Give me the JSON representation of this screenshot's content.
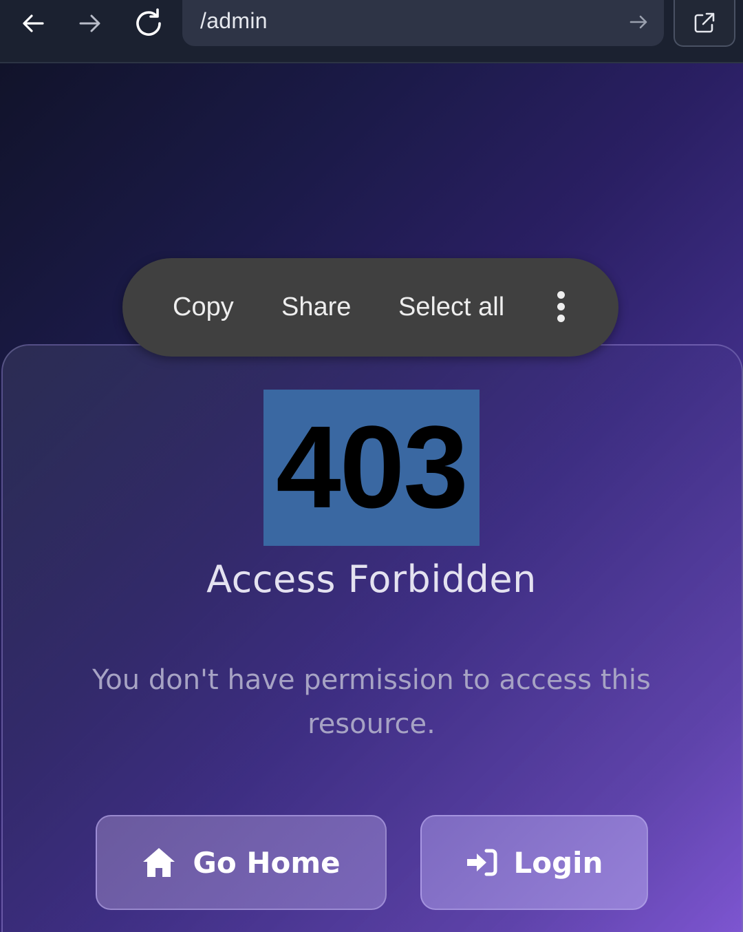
{
  "browser": {
    "url": "/admin",
    "icons": {
      "back": "arrow-left-icon",
      "forward": "arrow-right-icon",
      "reload": "reload-icon",
      "go": "arrow-right-icon",
      "open_external": "external-link-icon"
    }
  },
  "page": {
    "status_code": "403",
    "title": "Access Forbidden",
    "message": "You don't have permission to access this resource.",
    "buttons": {
      "home_label": "Go Home",
      "home_icon": "home-icon",
      "login_label": "Login",
      "login_icon": "sign-in-icon"
    }
  },
  "context_menu": {
    "copy": "Copy",
    "share": "Share",
    "select_all": "Select all",
    "more_icon": "more-vertical-icon"
  },
  "colors": {
    "selection": "#3a68a2",
    "context_menu_bg": "#404040",
    "toolbar_bg": "#1b2130"
  }
}
